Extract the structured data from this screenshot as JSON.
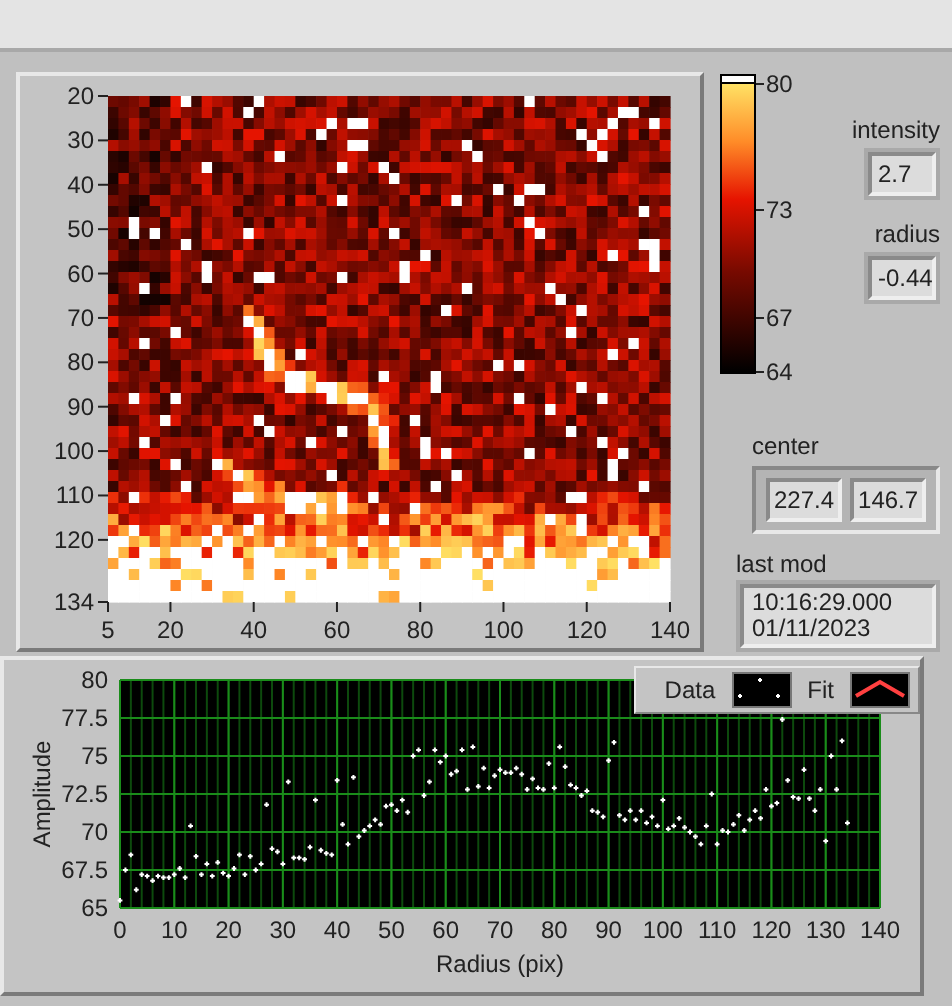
{
  "intensity_graph": {
    "y_ticks": [
      "20",
      "30",
      "40",
      "50",
      "60",
      "70",
      "80",
      "90",
      "100",
      "110",
      "120",
      "134"
    ],
    "x_ticks": [
      "5",
      "20",
      "40",
      "60",
      "80",
      "100",
      "120",
      "140"
    ]
  },
  "color_scale": {
    "ticks": [
      "80",
      "73",
      "67",
      "64"
    ]
  },
  "indicators": [
    {
      "label": "intensity",
      "value": "2.7"
    },
    {
      "label": "radius",
      "value": "-0.44"
    }
  ],
  "center": {
    "label": "center",
    "values": [
      "227.4",
      "146.7"
    ]
  },
  "last_mod": {
    "label": "last mod",
    "lines": [
      "10:16:29.000",
      "01/11/2023"
    ]
  },
  "amplitude_chart": {
    "legend": [
      {
        "kind": "points"
      },
      {
        "label": "Fit",
        "kind": "line"
      }
    ],
    "chart_data": {
      "type": "scatter",
      "grid": true,
      "xlabel": "Radius (pix)",
      "ylabel": "Amplitude",
      "xlim": [
        0,
        140
      ],
      "ylim": [
        65,
        80
      ],
      "xticks": [
        0,
        10,
        20,
        30,
        40,
        50,
        60,
        70,
        80,
        90,
        100,
        110,
        120,
        130,
        140
      ],
      "yticks": [
        65,
        67.5,
        70,
        72.5,
        75,
        77.5,
        80
      ],
      "x": [
        0,
        1,
        2,
        3,
        4,
        5,
        6,
        7,
        8,
        9,
        10,
        11,
        12,
        13,
        14,
        15,
        16,
        17,
        18,
        19,
        20,
        21,
        22,
        23,
        24,
        25,
        26,
        27,
        28,
        29,
        30,
        31,
        32,
        33,
        34,
        35,
        36,
        37,
        38,
        39,
        40,
        41,
        42,
        43,
        44,
        45,
        46,
        47,
        48,
        49,
        50,
        51,
        52,
        53,
        54,
        55,
        56,
        57,
        58,
        59,
        60,
        61,
        62,
        63,
        64,
        65,
        66,
        67,
        68,
        69,
        70,
        71,
        72,
        73,
        74,
        75,
        76,
        77,
        78,
        79,
        80,
        81,
        82,
        83,
        84,
        85,
        86,
        87,
        88,
        89,
        90,
        91,
        92,
        93,
        94,
        95,
        96,
        97,
        98,
        99,
        100,
        101,
        102,
        103,
        104,
        105,
        106,
        107,
        108,
        109,
        110,
        111,
        112,
        113,
        114,
        115,
        116,
        117,
        118,
        119,
        120,
        121,
        122,
        123,
        124,
        125,
        126,
        127,
        128,
        129,
        130,
        131,
        132,
        133,
        134
      ],
      "series": [
        {
          "name": "Data",
          "color": "#ffffff",
          "values": [
            65.5,
            67.5,
            68.5,
            66.2,
            67.2,
            67.1,
            66.8,
            67.1,
            67.0,
            67.0,
            67.2,
            67.6,
            67.0,
            70.4,
            68.4,
            67.2,
            67.9,
            67.1,
            68.0,
            67.3,
            67.1,
            67.6,
            68.5,
            67.2,
            68.4,
            67.5,
            67.9,
            71.8,
            68.9,
            68.7,
            67.9,
            73.3,
            68.3,
            68.3,
            68.2,
            69.0,
            72.1,
            68.8,
            68.6,
            68.5,
            73.4,
            70.5,
            69.2,
            73.6,
            69.7,
            70.1,
            70.4,
            70.8,
            70.5,
            71.7,
            71.8,
            71.4,
            72.1,
            71.3,
            75.0,
            75.4,
            72.4,
            73.3,
            75.4,
            74.6,
            75.0,
            73.8,
            74.0,
            75.4,
            72.8,
            75.6,
            73.0,
            74.2,
            72.9,
            73.7,
            74.1,
            73.9,
            73.9,
            74.2,
            73.8,
            72.8,
            73.5,
            72.9,
            72.8,
            74.5,
            72.9,
            75.6,
            74.3,
            73.1,
            72.9,
            72.4,
            72.7,
            71.4,
            71.3,
            71.0,
            74.7,
            75.9,
            71.1,
            70.8,
            71.4,
            70.8,
            71.4,
            70.6,
            71.0,
            70.4,
            72.1,
            70.2,
            70.4,
            70.9,
            70.3,
            70.0,
            69.7,
            69.2,
            70.4,
            72.5,
            69.2,
            70.1,
            70.0,
            70.5,
            71.1,
            70.1,
            70.8,
            71.4,
            70.9,
            72.8,
            71.7,
            71.9,
            77.4,
            73.4,
            72.3,
            72.2,
            74.1,
            72.2,
            71.4,
            72.8,
            69.4,
            75.0,
            72.8,
            76.0,
            70.6
          ]
        }
      ]
    }
  }
}
